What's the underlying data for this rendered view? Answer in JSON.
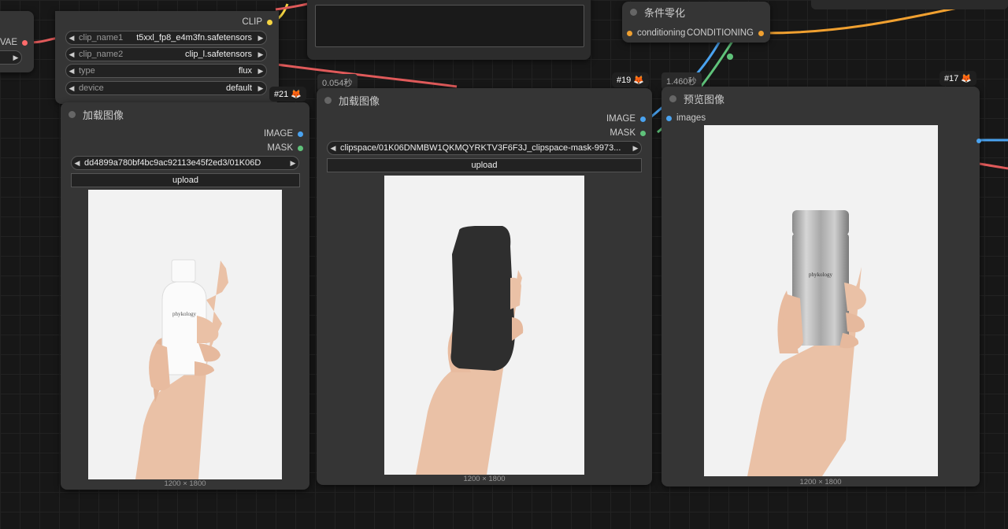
{
  "vae_node": {
    "output_label": "VAE"
  },
  "clip_node": {
    "output_label": "CLIP",
    "widgets": [
      {
        "label": "clip_name1",
        "value": "t5xxl_fp8_e4m3fn.safetensors"
      },
      {
        "label": "clip_name2",
        "value": "clip_l.safetensors"
      },
      {
        "label": "type",
        "value": "flux"
      },
      {
        "label": "device",
        "value": "default"
      }
    ]
  },
  "cond_node": {
    "title": "条件零化",
    "input_label": "conditioning",
    "output_label": "CONDITIONING"
  },
  "load_image_1": {
    "badge": "#21",
    "title": "加载图像",
    "outputs": [
      "IMAGE",
      "MASK"
    ],
    "file": "dd4899a780bf4bc9ac92113e45f2ed3/01K06D",
    "upload_label": "upload",
    "dims": "1200 × 1800"
  },
  "load_image_2": {
    "badge": "#19",
    "timer": "0.054秒",
    "title": "加载图像",
    "outputs": [
      "IMAGE",
      "MASK"
    ],
    "file": "clipspace/01K06DNMBW1QKMQYRKTV3F6F3J_clipspace-mask-9973...",
    "upload_label": "upload",
    "dims": "1200 × 1800"
  },
  "preview_node": {
    "badge": "#17",
    "timer": "1.460秒",
    "title": "预览图像",
    "input_label": "images",
    "dims": "1200 × 1800"
  },
  "product_text": {
    "brand": "phykology"
  },
  "colors": {
    "image_slot": "#4aa3f0",
    "mask_slot": "#5fc27a",
    "clip_slot": "#f5d442",
    "vae_slot": "#ff6b6b",
    "cond_slot": "#f0a030"
  }
}
